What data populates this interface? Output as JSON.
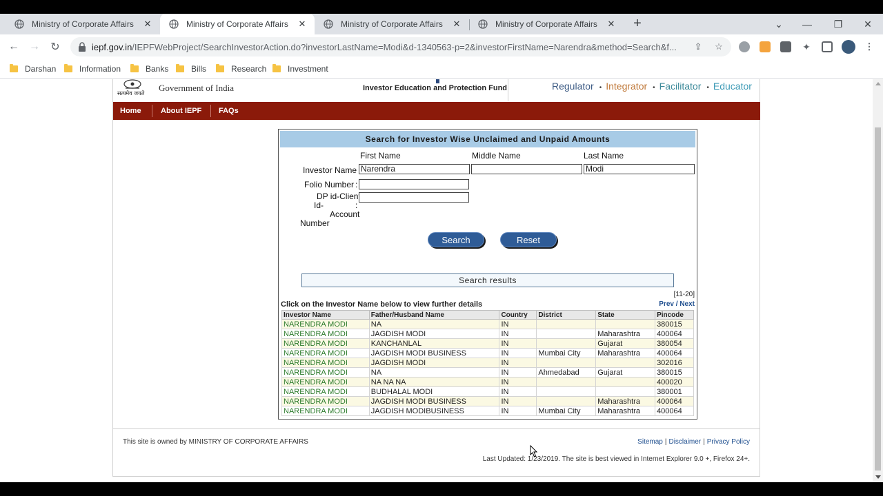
{
  "browser": {
    "tabs": [
      {
        "title": "Ministry of Corporate Affairs",
        "active": false
      },
      {
        "title": "Ministry of Corporate Affairs",
        "active": true
      },
      {
        "title": "Ministry of Corporate Affairs",
        "active": false
      },
      {
        "title": "Ministry of Corporate Affairs",
        "active": false
      }
    ],
    "url_host": "iepf.gov.in",
    "url_path": "/IEPFWebProject/SearchInvestorAction.do?investorLastName=Modi&d-1340563-p=2&investorFirstName=Narendra&method=Search&f...",
    "bookmarks": [
      "Darshan",
      "Information",
      "Banks",
      "Bills",
      "Research",
      "Investment"
    ]
  },
  "site": {
    "gov_title": "Government of India",
    "emblem_text": "सत्यमेव जयते",
    "iepf_title": "Investor Education and Protection Fund",
    "tagline": {
      "regulator": "Regulator",
      "integrator": "Integrator",
      "facilitator": "Facilitator",
      "educator": "Educator",
      "dot": "•"
    },
    "nav": [
      "Home",
      "About IEPF",
      "FAQs"
    ]
  },
  "search": {
    "heading": "Search for Investor Wise Unclaimed and Unpaid Amounts",
    "col_first": "First Name",
    "col_middle": "Middle Name",
    "col_last": "Last Name",
    "investor_name_label": "Investor Name :",
    "first_name_value": "Narendra",
    "middle_name_value": "",
    "last_name_value": "Modi",
    "folio_label": "Folio Number",
    "colon": ":",
    "dp_label_1": "DP id-Client",
    "dp_label_2": "Id-",
    "dp_label_3": ":",
    "dp_label_4": "Account",
    "dp_label_5": "Number",
    "search_btn": "Search",
    "reset_btn": "Reset"
  },
  "results": {
    "bar_label": "Search results",
    "range": "[11-20]",
    "note": "Click on the Investor Name below to view further details",
    "prev": "Prev",
    "slash": " / ",
    "next": "Next",
    "headers": [
      "Investor Name",
      "Father/Husband Name",
      "Country",
      "District",
      "State",
      "Pincode"
    ],
    "rows": [
      [
        "NARENDRA MODI",
        "NA",
        "IN",
        "",
        "",
        "380015"
      ],
      [
        "NARENDRA MODI",
        "JAGDISH MODI",
        "IN",
        "",
        "Maharashtra",
        "400064"
      ],
      [
        "NARENDRA MODI",
        "KANCHANLAL",
        "IN",
        "",
        "Gujarat",
        "380054"
      ],
      [
        "NARENDRA MODI",
        "JAGDISH MODI BUSINESS",
        "IN",
        "Mumbai City",
        "Maharashtra",
        "400064"
      ],
      [
        "NARENDRA MODI",
        "JAGDISH MODI",
        "IN",
        "",
        "",
        "302016"
      ],
      [
        "NARENDRA MODI",
        "NA",
        "IN",
        "Ahmedabad",
        "Gujarat",
        "380015"
      ],
      [
        "NARENDRA MODI",
        "NA NA NA",
        "IN",
        "",
        "",
        "400020"
      ],
      [
        "NARENDRA MODI",
        "BUDHALAL MODI",
        "IN",
        "",
        "",
        "380001"
      ],
      [
        "NARENDRA MODI",
        "JAGDISH MODI BUSINESS",
        "IN",
        "",
        "Maharashtra",
        "400064"
      ],
      [
        "NARENDRA MODI",
        "JAGDISH MODIBUSINESS",
        "IN",
        "Mumbai City",
        "Maharashtra",
        "400064"
      ]
    ]
  },
  "footer": {
    "owner_prefix": "This site is owned by ",
    "owner_name": "MINISTRY OF CORPORATE AFFAIRS",
    "links": [
      "Sitemap",
      "Disclaimer",
      "Privacy Policy"
    ],
    "link_sep": "|",
    "last_updated": "Last Updated:  1/23/2019. The site is best viewed in Internet Explorer 9.0 +, Firefox 24+."
  },
  "colors": {
    "navbar": "#8b1a0a",
    "regulator": "#3f5d86",
    "integrator": "#c0793a",
    "facilitator": "#3d8a9a",
    "educator": "#3c9ab6",
    "button": "#2f5c97",
    "heading_bg": "#a8cbe6"
  }
}
